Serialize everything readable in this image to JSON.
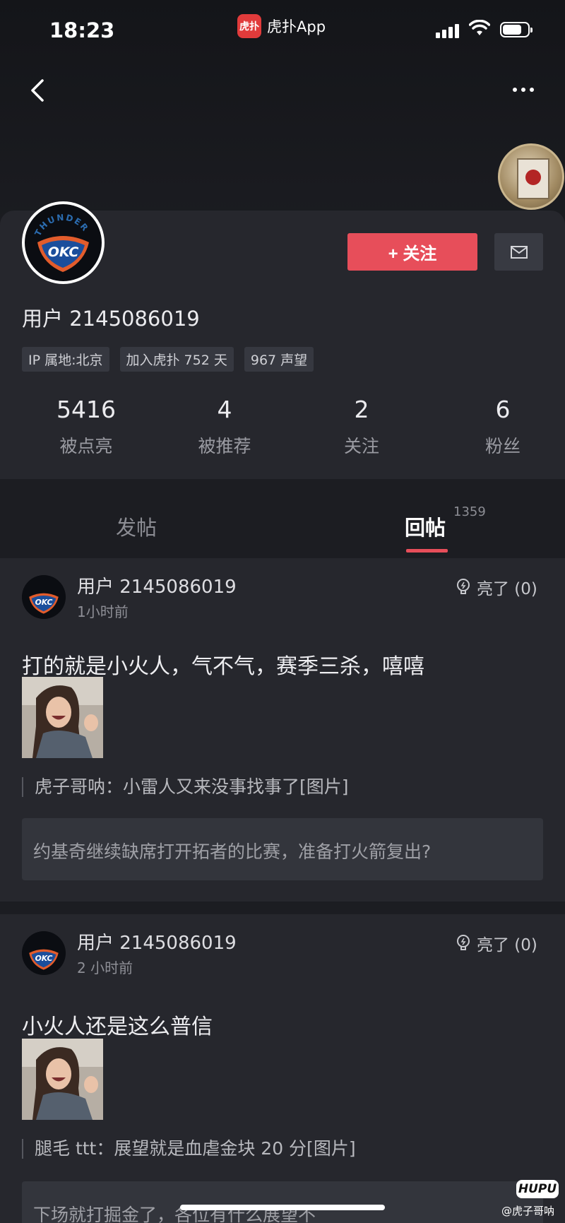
{
  "status_bar": {
    "time": "18:23",
    "app_name": "虎扑App",
    "app_logo_text": "虎扑",
    "battery_level": 0.75
  },
  "colors": {
    "accent": "#e74e5a",
    "background": "#1c1d22",
    "card": "#26272d"
  },
  "header": {
    "back_icon": "chevron-left-icon",
    "more_icon": "ellipsis-icon"
  },
  "profile": {
    "username": "用户 2145086019",
    "avatar_text": "OKC",
    "avatar_ring_text": "THUNDER",
    "follow_label": "+ 关注",
    "message_icon": "envelope-icon",
    "tags": [
      "IP 属地:北京",
      "加入虎扑 752 天",
      "967 声望"
    ],
    "stats": [
      {
        "value": "5416",
        "label": "被点亮"
      },
      {
        "value": "4",
        "label": "被推荐"
      },
      {
        "value": "2",
        "label": "关注"
      },
      {
        "value": "6",
        "label": "粉丝"
      }
    ]
  },
  "tabs": {
    "posts": "发帖",
    "replies": "回帖",
    "replies_count": "1359"
  },
  "feed": [
    {
      "user": "用户 2145086019",
      "time": "1小时前",
      "light": "亮了 (0)",
      "text": "打的就是小火人，气不气，赛季三杀，嘻嘻",
      "quote": "虎子哥呐：小雷人又来没事找事了[图片]",
      "context": "约基奇继续缺席打开拓者的比赛，准备打火箭复出?"
    },
    {
      "user": "用户 2145086019",
      "time": "2 小时前",
      "light": "亮了 (0)",
      "text": "小火人还是这么普信",
      "quote": "腿毛 ttt：展望就是血虐金块 20 分[图片]",
      "context": "下场就打掘金了，各位有什么展望不"
    }
  ],
  "watermark": {
    "logo": "HUPU",
    "text": "@虎子哥呐"
  }
}
